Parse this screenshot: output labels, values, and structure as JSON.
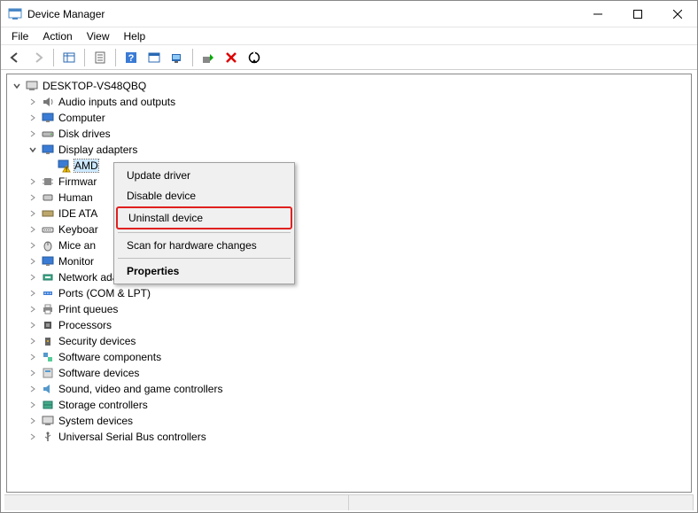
{
  "window": {
    "title": "Device Manager"
  },
  "menu": {
    "file": "File",
    "action": "Action",
    "view": "View",
    "help": "Help"
  },
  "tree": {
    "root": "DESKTOP-VS48QBQ",
    "items": {
      "audio": "Audio inputs and outputs",
      "computer": "Computer",
      "disk": "Disk drives",
      "display": "Display adapters",
      "display_child": "AMD",
      "firmware": "Firmwar",
      "hid": "Human",
      "ide": "IDE ATA",
      "keyboard": "Keyboar",
      "mice": "Mice an",
      "monitors": "Monitor",
      "network": "Network adapters",
      "ports": "Ports (COM & LPT)",
      "printq": "Print queues",
      "processors": "Processors",
      "security": "Security devices",
      "swcomp": "Software components",
      "swdev": "Software devices",
      "sound": "Sound, video and game controllers",
      "storage": "Storage controllers",
      "system": "System devices",
      "usb": "Universal Serial Bus controllers"
    }
  },
  "contextmenu": {
    "update": "Update driver",
    "disable": "Disable device",
    "uninstall": "Uninstall device",
    "scan": "Scan for hardware changes",
    "properties": "Properties"
  }
}
